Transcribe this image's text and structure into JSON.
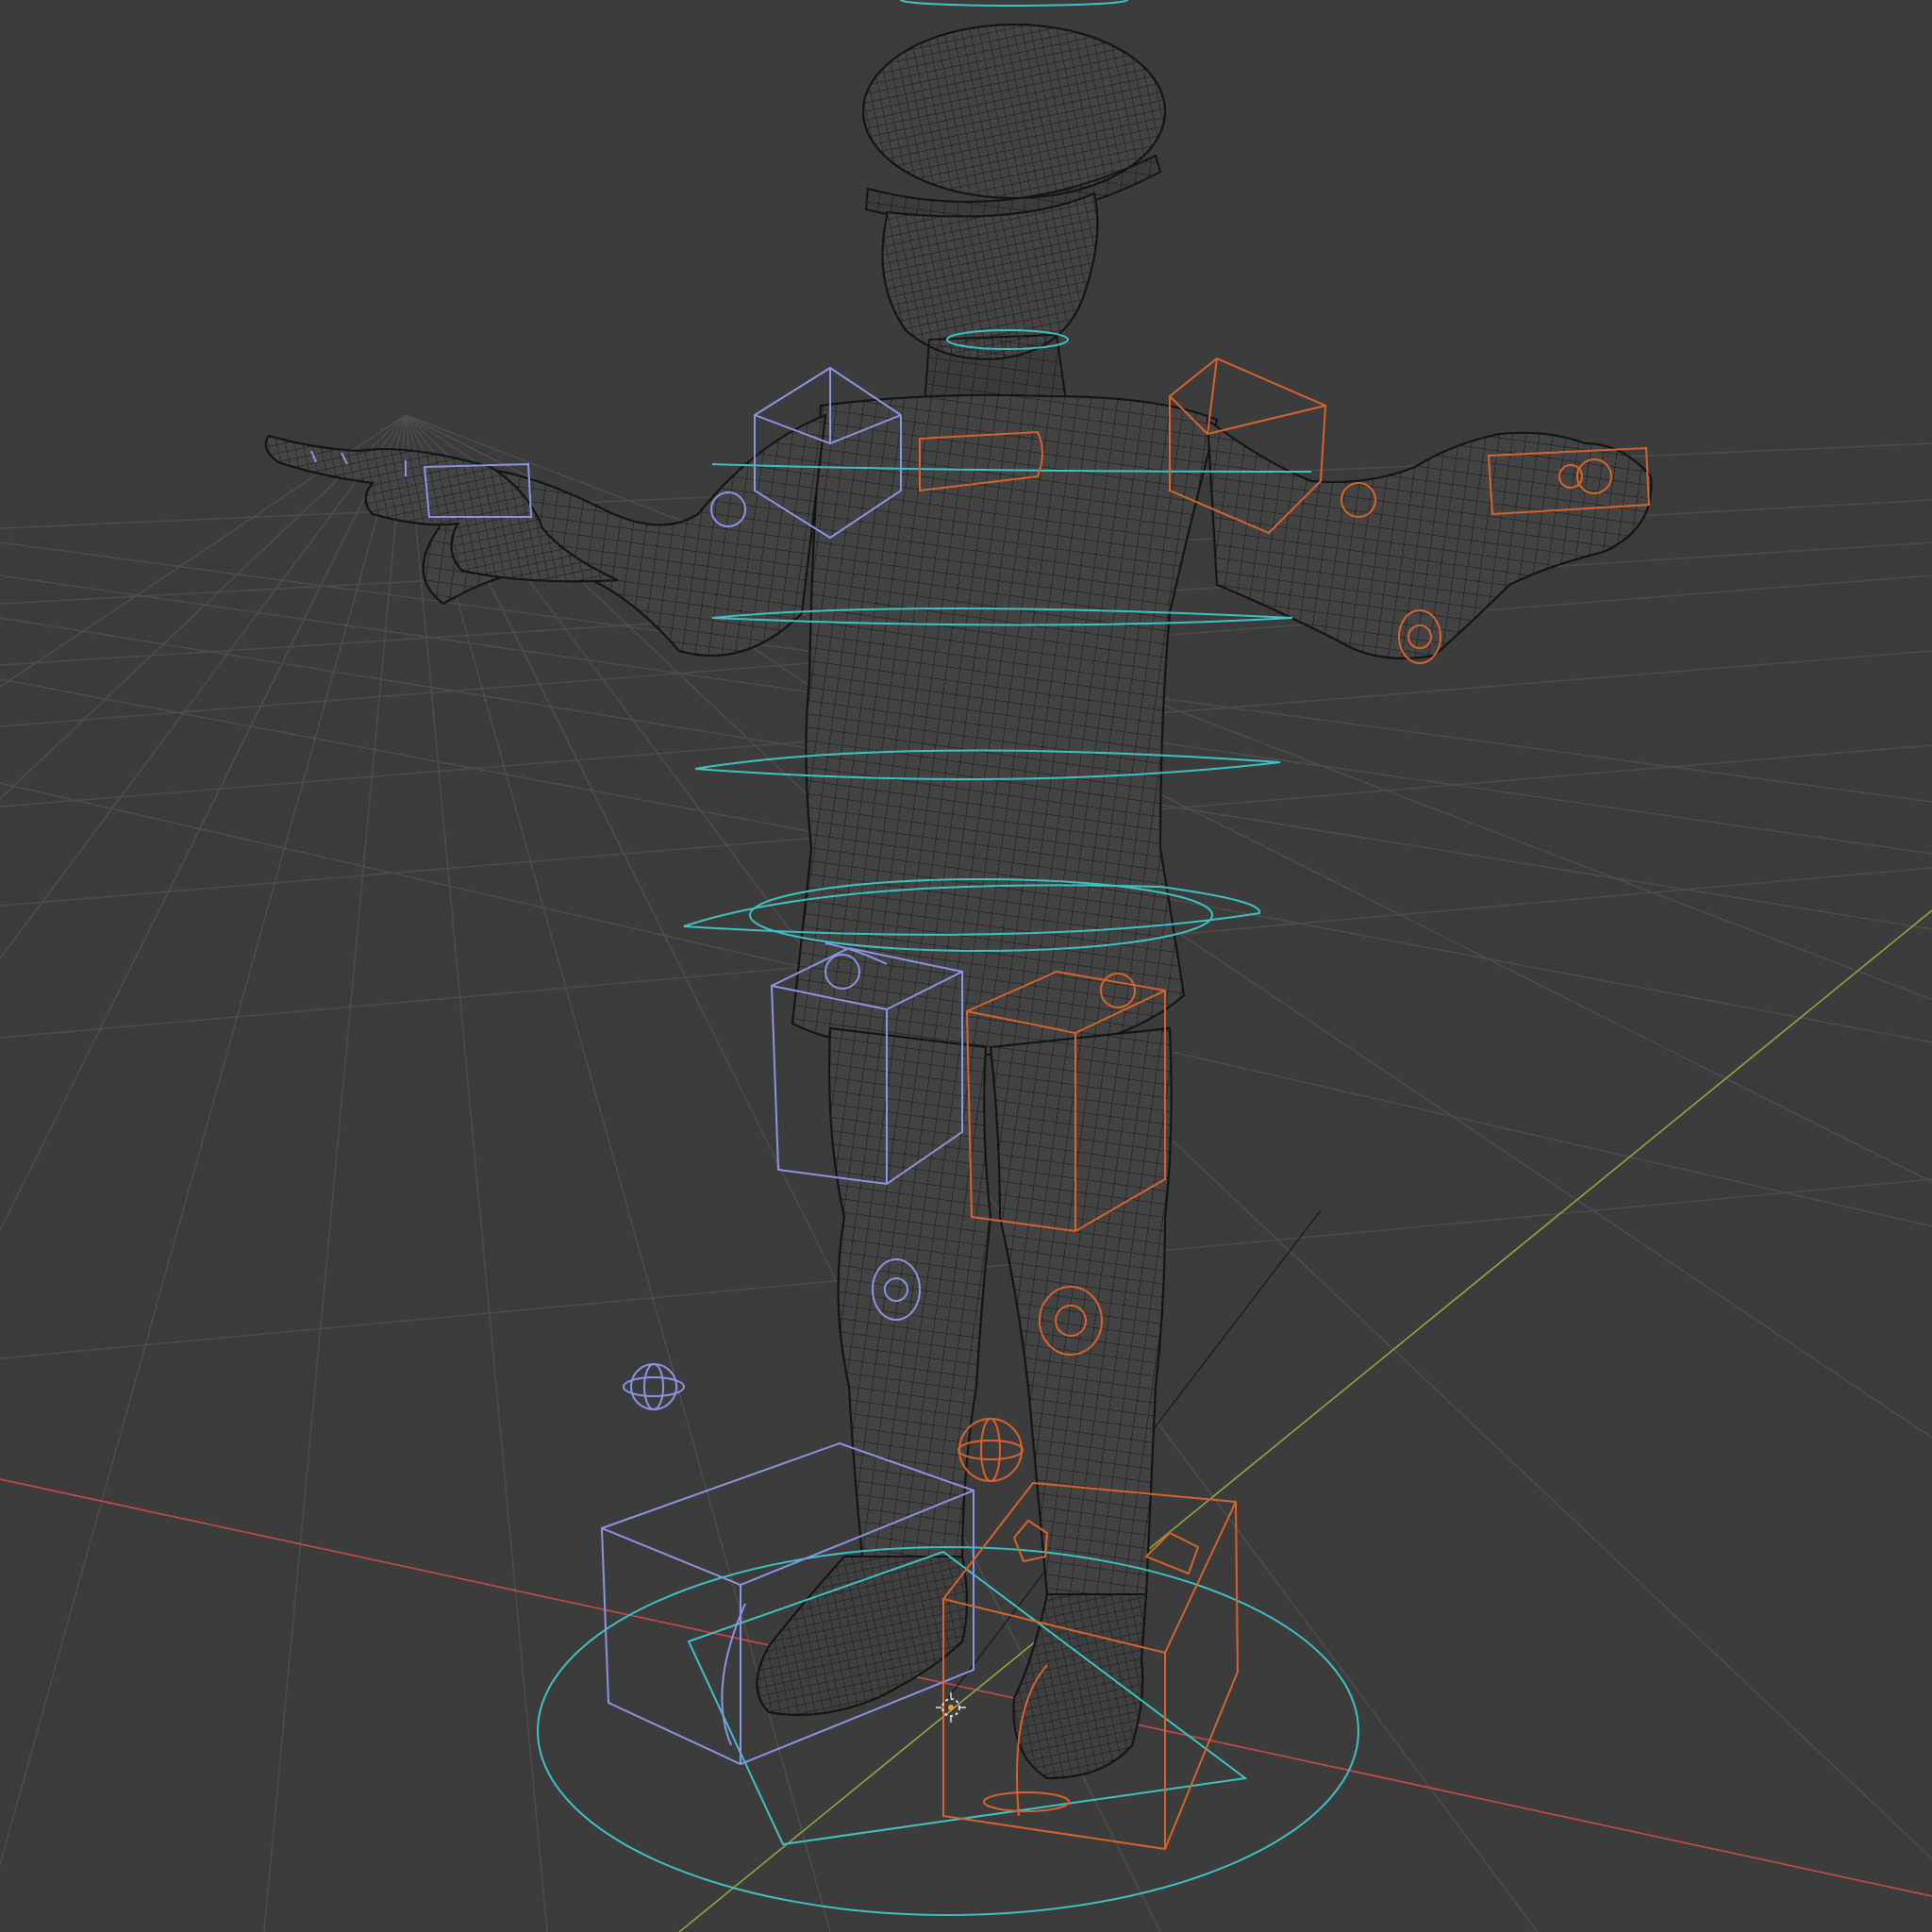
{
  "viewport": {
    "view_mode": "wireframe",
    "background_color": "#3c3c3c",
    "grid_color": "#4e4e4e",
    "axis_x_color": "#c84a4a",
    "axis_y_color": "#8faa3c",
    "mesh_wire_color": "#141414",
    "mesh_fill_color": "#454545"
  },
  "rig": {
    "left_side_color": "#8c94e6",
    "right_side_color": "#d8642a",
    "center_color": "#3cc4c4"
  }
}
